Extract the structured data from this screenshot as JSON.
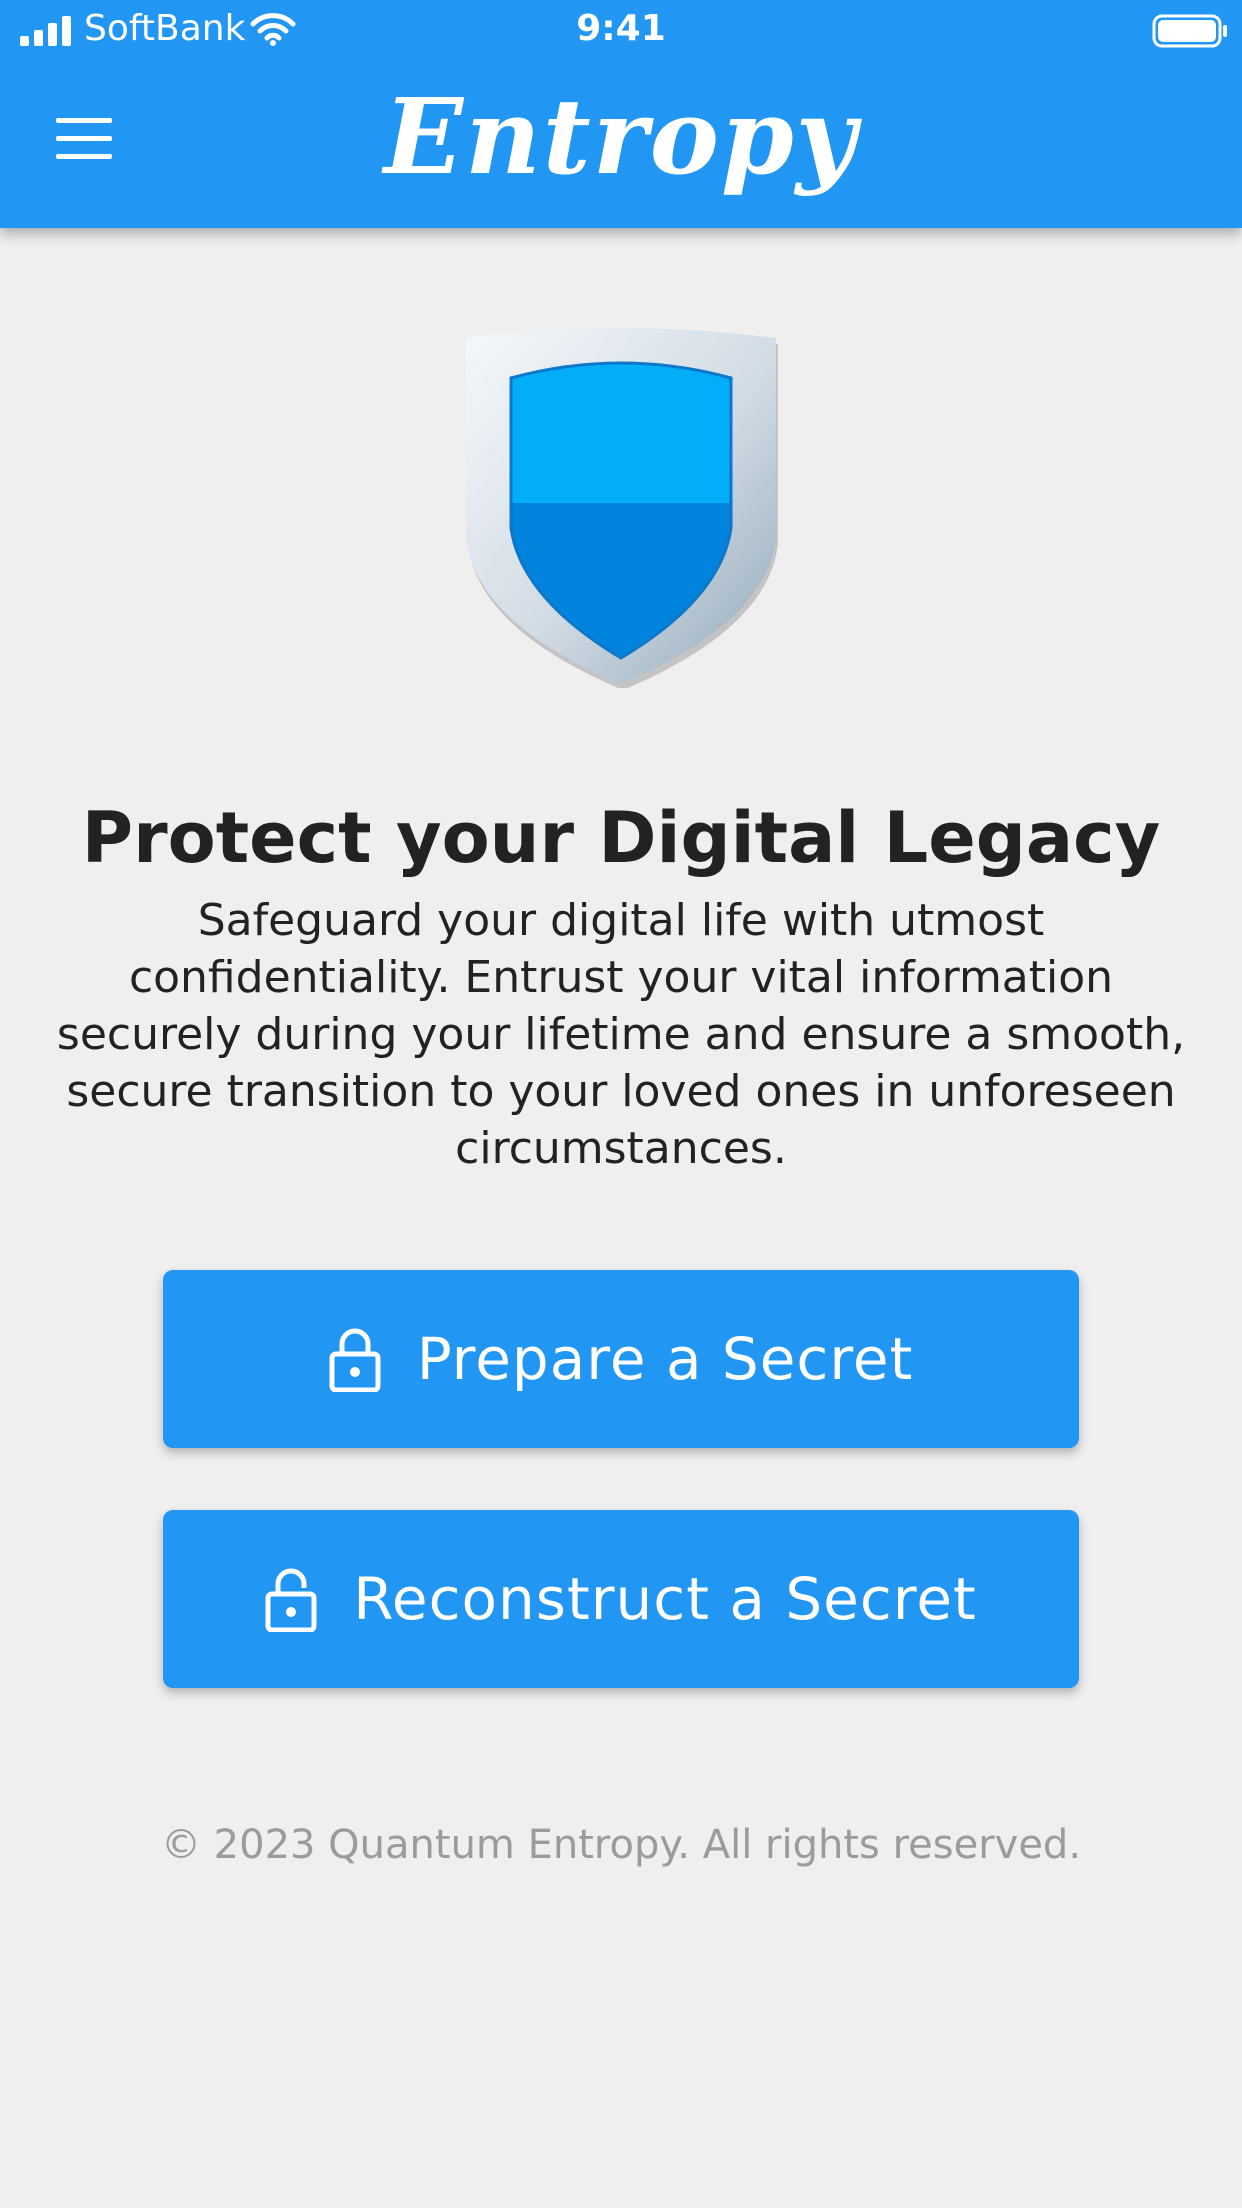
{
  "status_bar": {
    "carrier": "SoftBank",
    "time": "9:41"
  },
  "header": {
    "app_title": "Entropy",
    "menu_icon": "hamburger-menu-icon"
  },
  "hero": {
    "icon": "shield-icon",
    "headline": "Protect your Digital Legacy",
    "description": "Safeguard your digital life with utmost confidentiality. Entrust your vital information securely during your lifetime and ensure a smooth, secure transition to your loved ones in unforeseen circumstances."
  },
  "actions": {
    "prepare_label": "Prepare a Secret",
    "prepare_icon": "lock-closed-icon",
    "reconstruct_label": "Reconstruct a Secret",
    "reconstruct_icon": "lock-open-icon"
  },
  "footer": {
    "copyright": "© 2023 Quantum Entropy. All rights reserved."
  },
  "colors": {
    "primary": "#2196f3",
    "background": "#efeff0",
    "text": "#222222",
    "muted": "#9b9b9b"
  }
}
